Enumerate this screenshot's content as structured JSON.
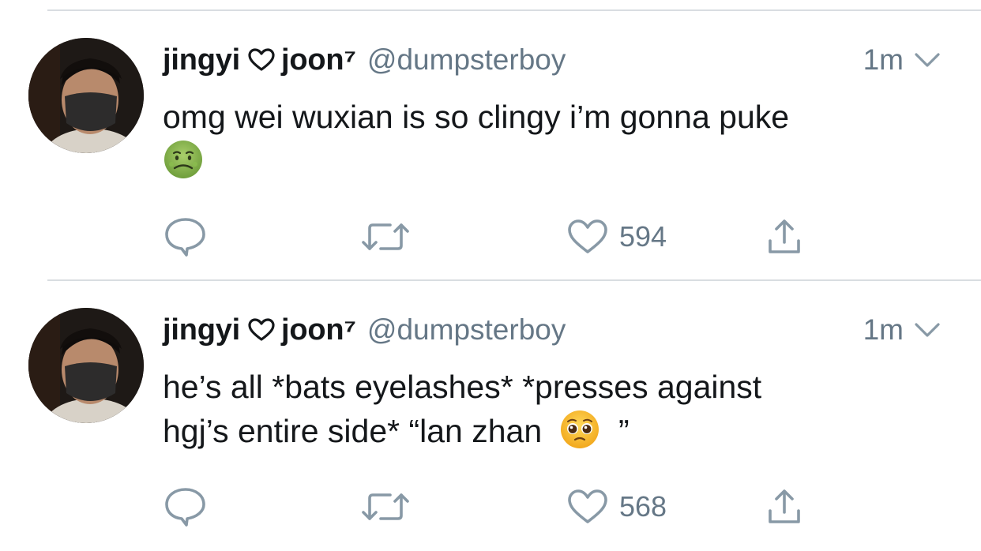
{
  "tweets": [
    {
      "display_name": "jingyi",
      "display_name_2": "joon⁷",
      "handle": "@dumpsterboy",
      "time": "1m",
      "text": "omg wei wuxian is so clingy i’m gonna puke",
      "emoji": "nauseated-face",
      "like_count": "594"
    },
    {
      "display_name": "jingyi",
      "display_name_2": "joon⁷",
      "handle": "@dumpsterboy",
      "time": "1m",
      "text_line1": "he’s all *bats eyelashes* *presses against",
      "text_line2": "hgj’s entire side* “lan zhan",
      "text_close_quote": "”",
      "emoji": "pleading-face",
      "like_count": "568"
    }
  ],
  "colors": {
    "text": "#14171a",
    "secondary": "#657786",
    "divider": "#d9dde1",
    "icon": "#8899a6"
  }
}
